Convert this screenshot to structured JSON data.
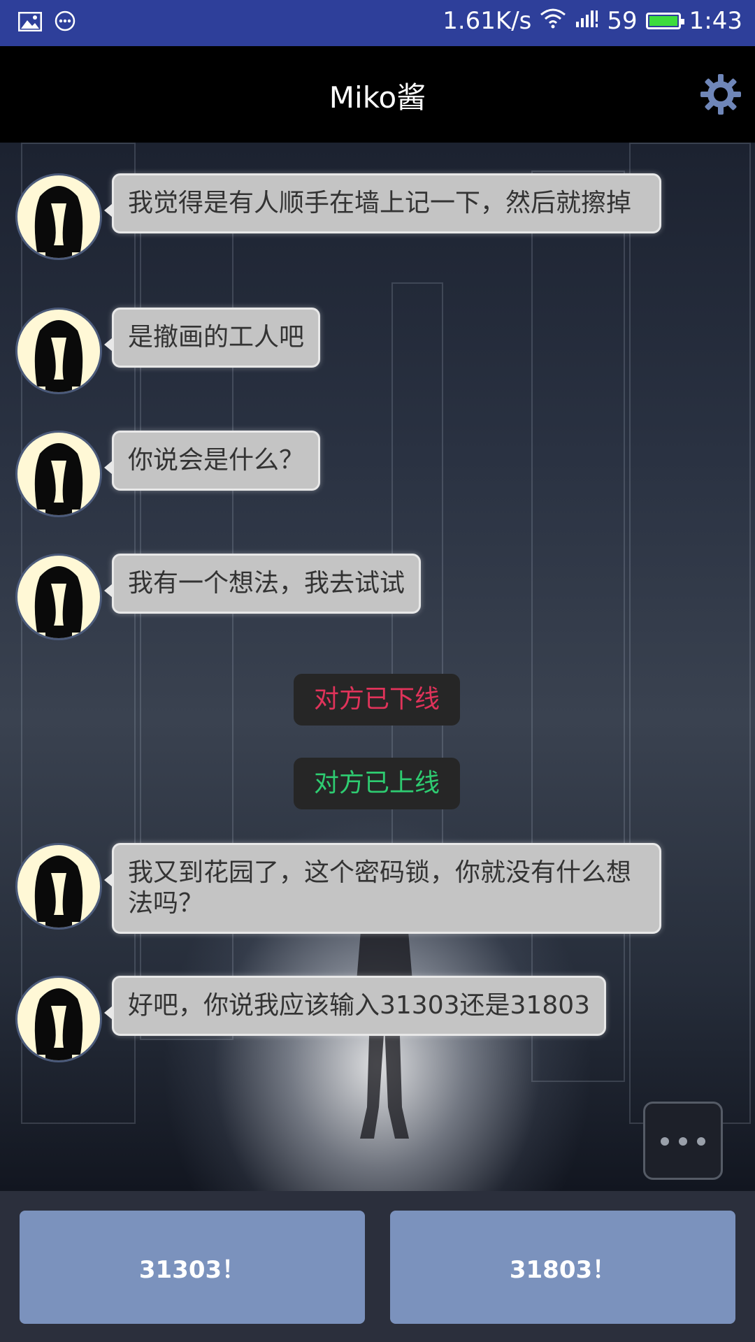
{
  "status_bar": {
    "speed": "1.61K/s",
    "signal_text": "59",
    "time": "1:43",
    "icons": [
      "image-icon",
      "more-icon",
      "wifi-icon",
      "signal-icon",
      "battery-icon"
    ],
    "battery_color": "#3ddc3d"
  },
  "header": {
    "title": "Miko酱",
    "settings_icon": "gear-icon"
  },
  "messages": [
    {
      "text": "我觉得是有人顺手在墙上记一下，然后就擦掉"
    },
    {
      "text": "是撤画的工人吧"
    },
    {
      "text": "你说会是什么？"
    },
    {
      "text": "我有一个想法，我去试试"
    },
    {
      "text": "我又到花园了，这个密码锁，你就没有什么想法吗？"
    },
    {
      "text": "好吧，你说我应该输入31303还是31803"
    }
  ],
  "notices": [
    {
      "text": "对方已下线",
      "color": "#e0335a"
    },
    {
      "text": "对方已上线",
      "color": "#2ecc71"
    }
  ],
  "typing_indicator": {
    "icon": "typing-dots-icon"
  },
  "choices": [
    {
      "label": "31303！"
    },
    {
      "label": "31803！"
    }
  ]
}
